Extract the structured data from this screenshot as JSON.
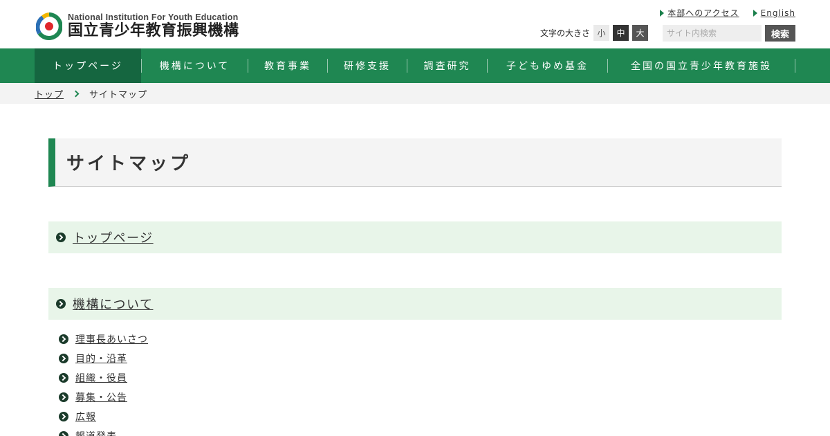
{
  "header": {
    "logo_en": "National Institution For Youth Education",
    "logo_ja": "国立青少年教育振興機構",
    "links": [
      {
        "label": "本部へのアクセス"
      },
      {
        "label": "English"
      }
    ],
    "font_size": {
      "label": "文字の大きさ",
      "small": "小",
      "medium": "中",
      "large": "大"
    },
    "search": {
      "placeholder": "サイト内検索",
      "button": "検索"
    }
  },
  "nav": {
    "items": [
      {
        "label": "トップページ",
        "active": true
      },
      {
        "label": "機構について"
      },
      {
        "label": "教育事業"
      },
      {
        "label": "研修支援"
      },
      {
        "label": "調査研究"
      },
      {
        "label": "子どもゆめ基金"
      },
      {
        "label": "全国の国立青少年教育施設"
      }
    ]
  },
  "breadcrumb": {
    "home": "トップ",
    "current": "サイトマップ"
  },
  "page": {
    "title": "サイトマップ"
  },
  "sections": [
    {
      "title": "トップページ"
    },
    {
      "title": "機構について",
      "items": [
        "理事長あいさつ",
        "目的・沿革",
        "組織・役員",
        "募集・公告",
        "広報",
        "報道発表"
      ]
    }
  ],
  "colors": {
    "brand_green": "#1f8752",
    "nav_active": "#156640",
    "section_bg": "#e8f5e9"
  }
}
